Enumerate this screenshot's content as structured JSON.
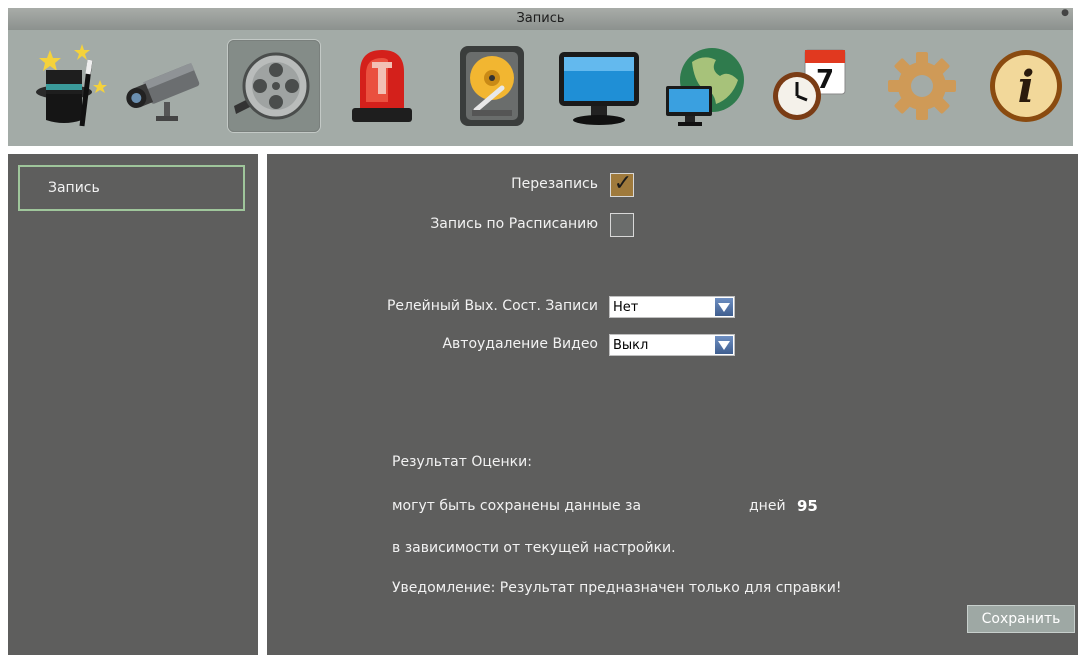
{
  "window": {
    "title": "Запись"
  },
  "toolbar": {
    "tools": [
      {
        "icon": "magic-hat-icon"
      },
      {
        "icon": "camera-icon"
      },
      {
        "icon": "film-reel-icon",
        "active": true
      },
      {
        "icon": "alarm-light-icon"
      },
      {
        "icon": "hard-disk-icon"
      },
      {
        "icon": "monitor-icon"
      },
      {
        "icon": "network-globe-icon"
      },
      {
        "icon": "clock-calendar-icon"
      },
      {
        "icon": "gear-icon"
      },
      {
        "icon": "info-icon"
      }
    ]
  },
  "sidebar": {
    "items": [
      {
        "label": "Запись",
        "selected": true
      }
    ]
  },
  "settings": {
    "overwrite": {
      "label": "Перезапись",
      "checked": true
    },
    "schedule_record": {
      "label": "Запись по Расписанию",
      "checked": false
    },
    "relay_out": {
      "label": "Релейный Вых. Сост. Записи",
      "value": "Нет"
    },
    "auto_delete": {
      "label": "Автоудаление Видео",
      "value": "Выкл"
    }
  },
  "estimate": {
    "title": "Результат Оценки:",
    "line1": "могут быть сохранены данные за",
    "days_label": "дней",
    "days_value": "95",
    "line2": "в зависимости от текущей настройки.",
    "notice": "Уведомление: Результат предназначен только для справки!"
  },
  "buttons": {
    "save": "Сохранить"
  },
  "colors": {
    "panel_bg": "#5e5e5d",
    "toolbar_bg": "#a3aba7",
    "checked_bg": "#9f7a3c",
    "highlight_border": "#9fc69b"
  }
}
